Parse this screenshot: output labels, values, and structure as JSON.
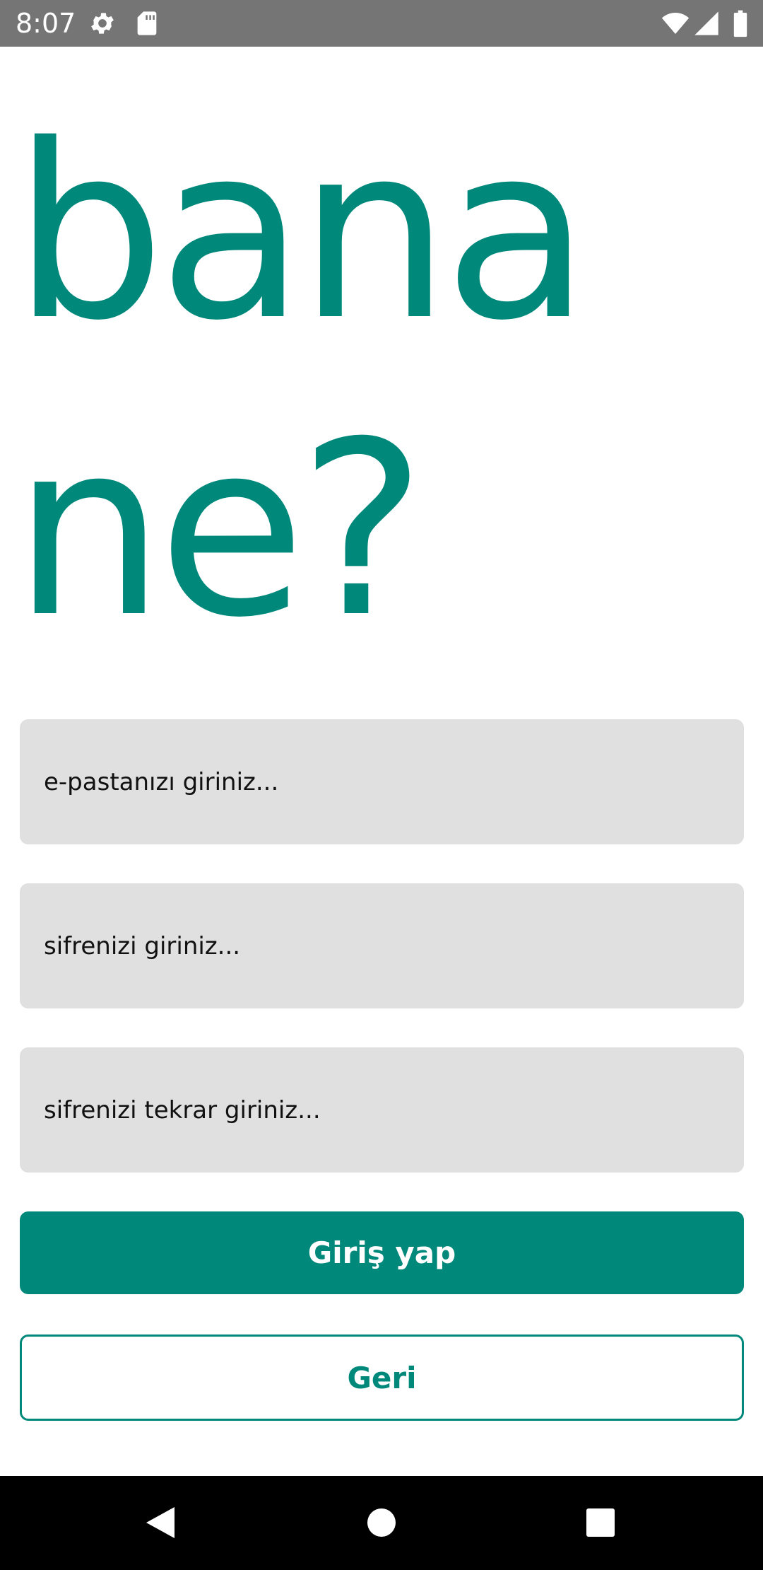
{
  "status_bar": {
    "time": "8:07",
    "icons": [
      "gear-icon",
      "sd-card-icon",
      "wifi-icon",
      "cellular-signal-icon",
      "battery-icon"
    ]
  },
  "app": {
    "title_line1": "bana",
    "title_line2": "ne?",
    "accent_color": "#00897b"
  },
  "form": {
    "email_placeholder": "e-pastanızı giriniz...",
    "password_placeholder": "sifrenizi giriniz...",
    "password_repeat_placeholder": "sifrenizi tekrar giriniz...",
    "submit_label": "Giriş yap",
    "back_label": "Geri"
  },
  "nav_bar": {
    "icons": [
      "back-triangle-icon",
      "home-circle-icon",
      "recents-square-icon"
    ]
  }
}
